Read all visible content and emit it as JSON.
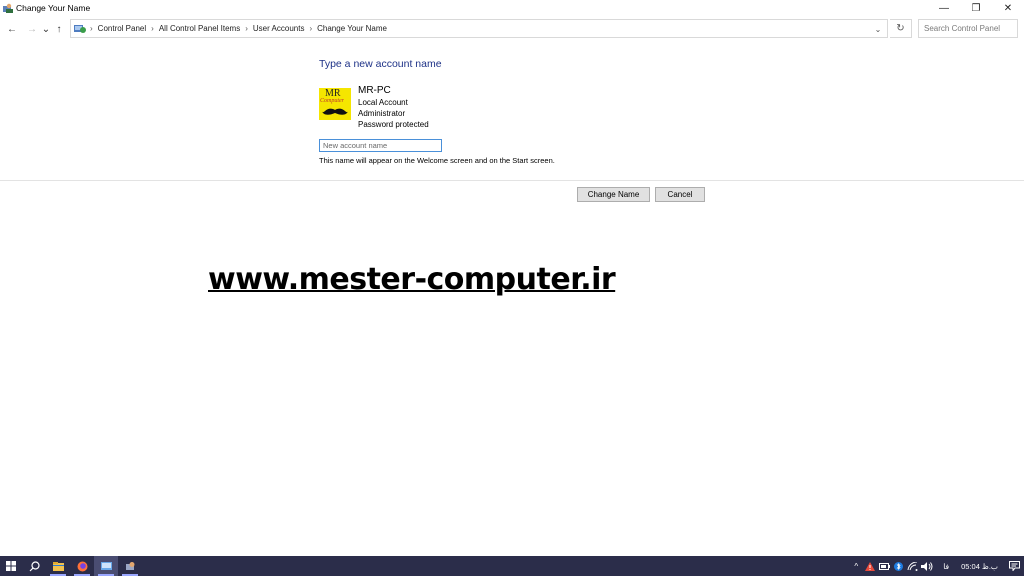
{
  "window": {
    "title": "Change Your Name",
    "controls": {
      "minimize": "—",
      "restore": "❐",
      "close": "✕"
    }
  },
  "nav": {
    "back": "←",
    "forward": "→",
    "recent": "⌄",
    "up": "↑",
    "breadcrumb": [
      "Control Panel",
      "All Control Panel Items",
      "User Accounts",
      "Change Your Name"
    ],
    "separator": "›",
    "dropdown": "⌄",
    "refresh": "↻",
    "search_placeholder": "Search Control Panel"
  },
  "content": {
    "heading": "Type a new account name",
    "account": {
      "name": "MR-PC",
      "type": "Local Account",
      "role": "Administrator",
      "security": "Password protected",
      "avatar_text_top": "MR",
      "avatar_text_bottom": "Computer"
    },
    "input_placeholder": "New account name",
    "hint": "This name will appear on the Welcome screen and on the Start screen."
  },
  "buttons": {
    "change_name": "Change Name",
    "cancel": "Cancel"
  },
  "watermark": "www.mester-computer.ir",
  "taskbar": {
    "apps": [
      "start-icon",
      "search-icon",
      "file-explorer-icon",
      "firefox-icon",
      "control-panel-icon",
      "settings-app-icon"
    ],
    "tray": {
      "overflow": "^",
      "keyboard_lang": "فا",
      "time": "05:04",
      "period": "ب.ظ"
    }
  },
  "colors": {
    "heading": "#1e3287",
    "taskbar": "#2b2d4a",
    "input_border": "#4a90d9",
    "avatar_bg": "#f5e600"
  }
}
